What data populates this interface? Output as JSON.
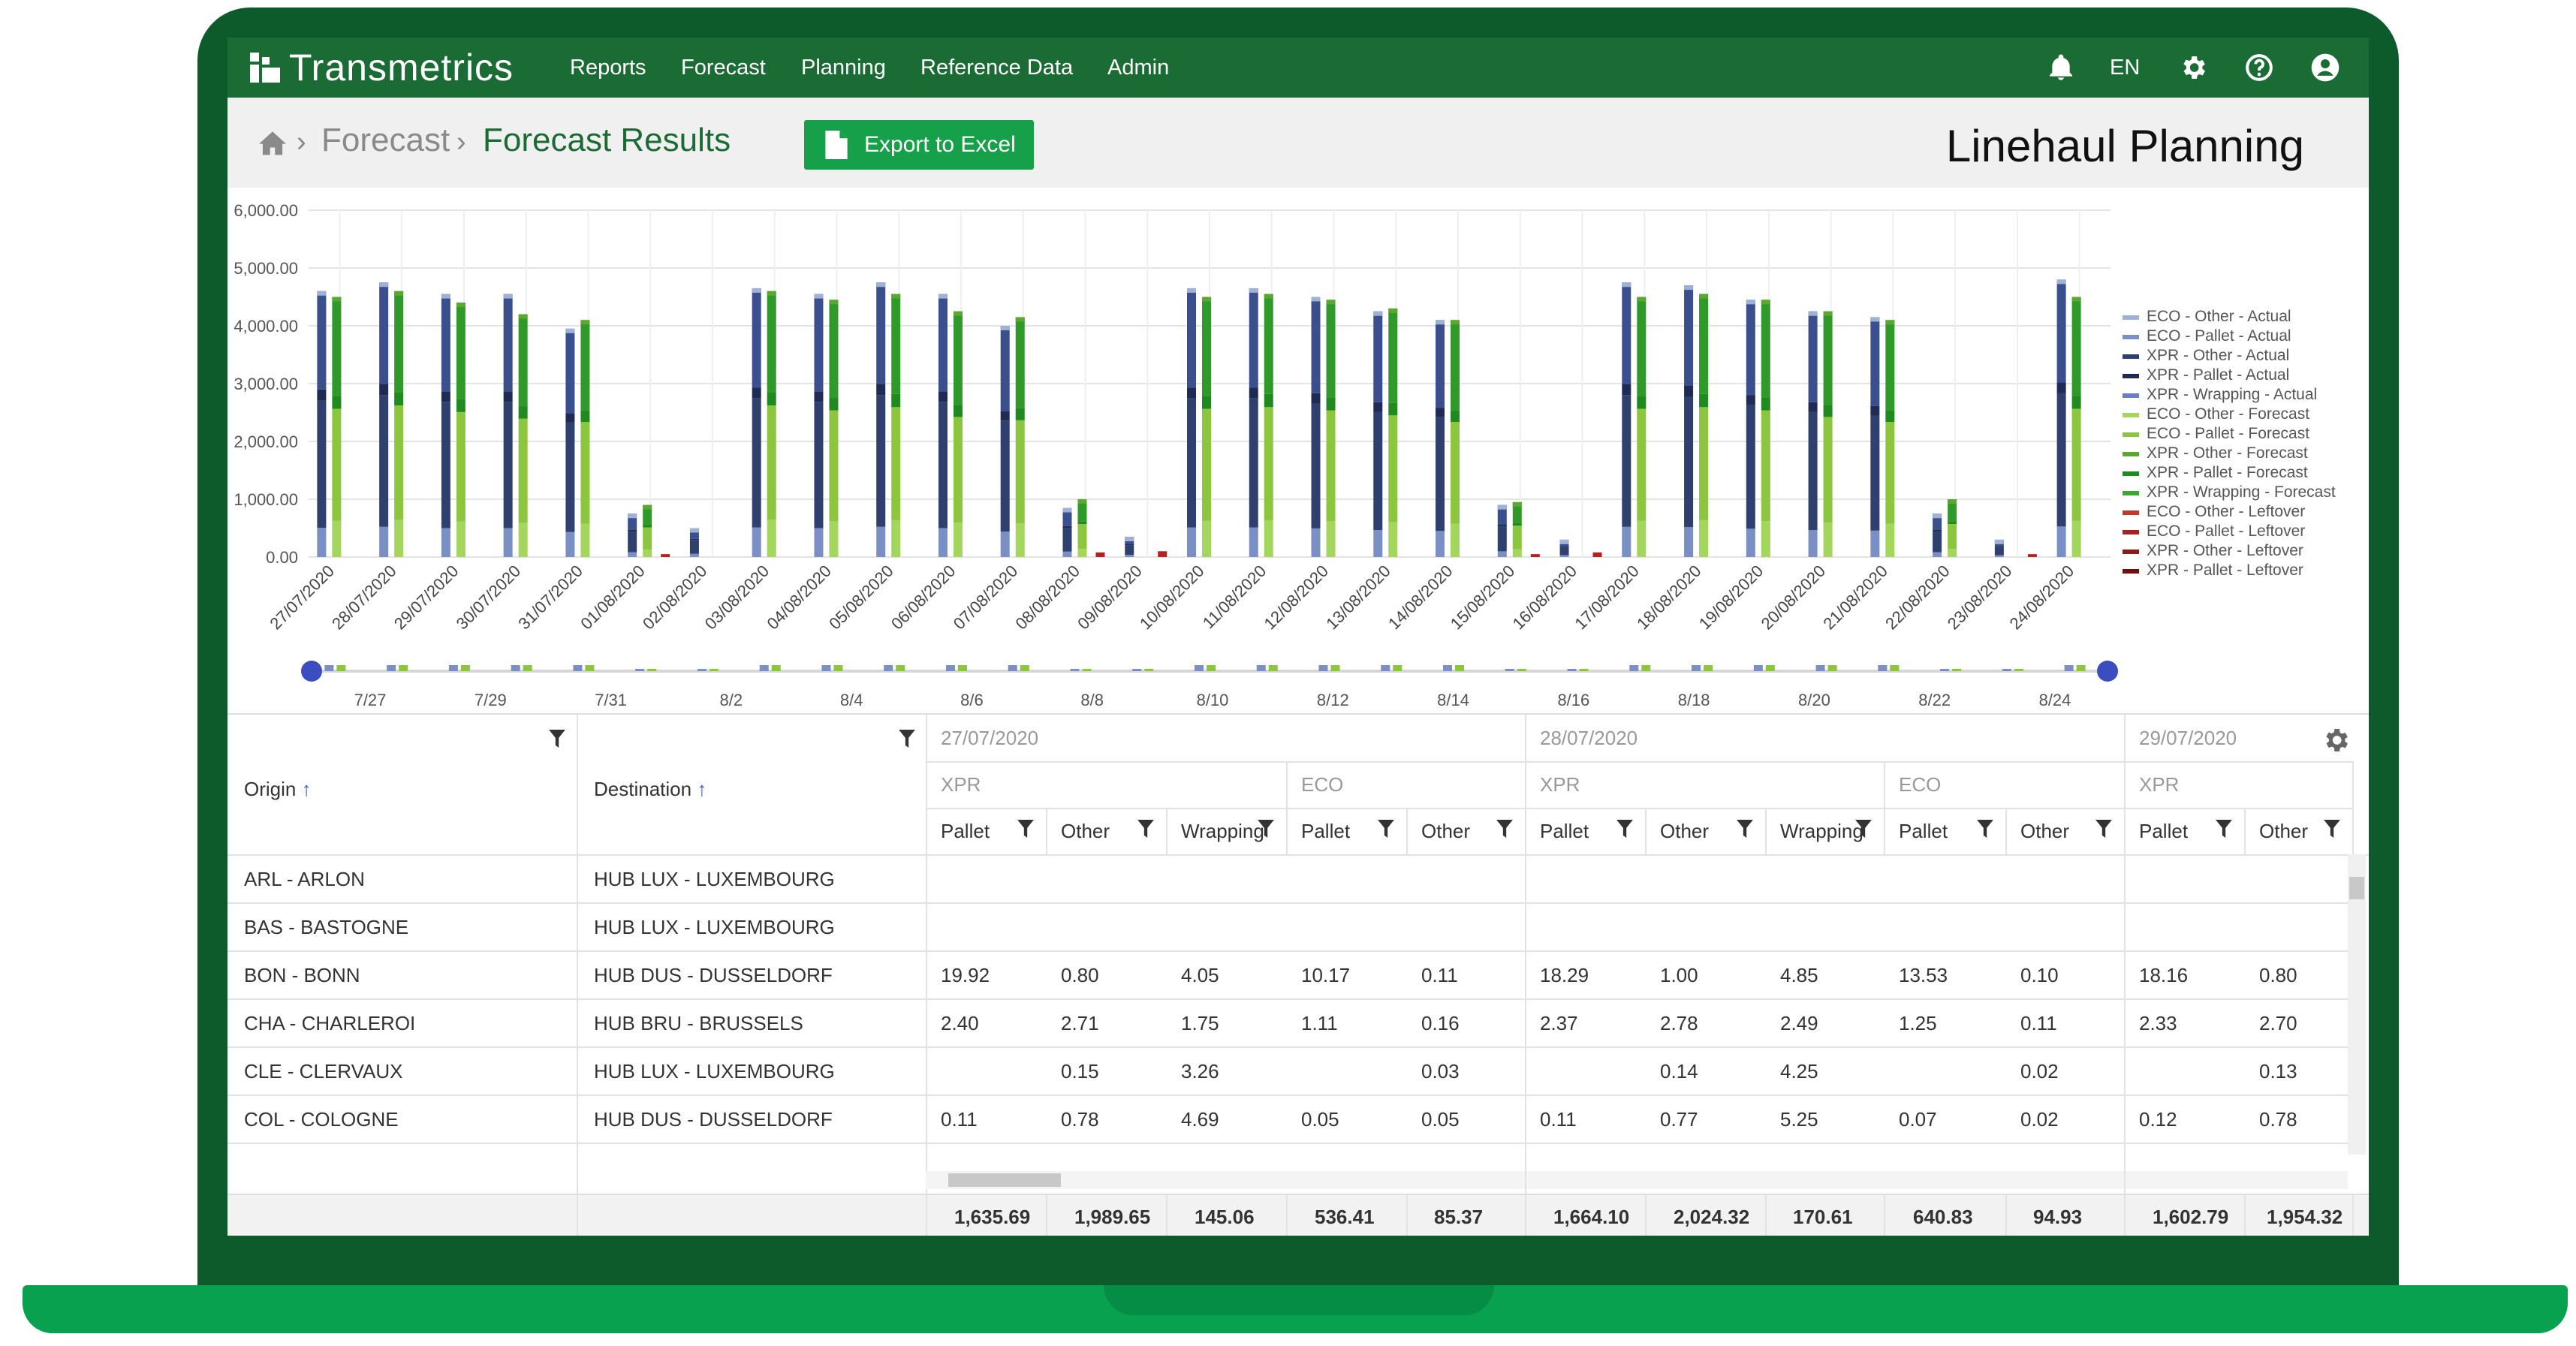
{
  "app": {
    "brand": "Transmetrics"
  },
  "nav": {
    "items": [
      "Reports",
      "Forecast",
      "Planning",
      "Reference Data",
      "Admin"
    ],
    "lang": "EN",
    "icons": [
      "bell-icon",
      "gear-icon",
      "help-icon",
      "user-icon"
    ]
  },
  "breadcrumb": {
    "parent": "Forecast",
    "current": "Forecast Results"
  },
  "toolbar": {
    "export_label": "Export to Excel"
  },
  "page": {
    "heading": "Linehaul Planning"
  },
  "colors": {
    "nav": "#1b6b34",
    "accent": "#17a04a"
  },
  "chart_data": {
    "type": "bar",
    "stacked": true,
    "grid": true,
    "legend_position": "right",
    "ylim": [
      0,
      6000
    ],
    "yticks": [
      "6,000.00",
      "5,000.00",
      "4,000.00",
      "3,000.00",
      "2,000.00",
      "1,000.00",
      "0.00"
    ],
    "categories": [
      "27/07/2020",
      "28/07/2020",
      "29/07/2020",
      "30/07/2020",
      "31/07/2020",
      "01/08/2020",
      "02/08/2020",
      "03/08/2020",
      "04/08/2020",
      "05/08/2020",
      "06/08/2020",
      "07/08/2020",
      "08/08/2020",
      "09/08/2020",
      "10/08/2020",
      "11/08/2020",
      "12/08/2020",
      "13/08/2020",
      "14/08/2020",
      "15/08/2020",
      "16/08/2020",
      "17/08/2020",
      "18/08/2020",
      "19/08/2020",
      "20/08/2020",
      "21/08/2020",
      "22/08/2020",
      "23/08/2020",
      "24/08/2020"
    ],
    "actual_totals": [
      4600,
      4750,
      4550,
      4550,
      3950,
      750,
      500,
      4650,
      4550,
      4750,
      4550,
      4000,
      850,
      350,
      4650,
      4650,
      4500,
      4250,
      4100,
      900,
      300,
      4750,
      4700,
      4450,
      4250,
      4150,
      750,
      300,
      4800
    ],
    "forecast_totals": [
      4500,
      4600,
      4400,
      4200,
      4100,
      900,
      0,
      4600,
      4450,
      4550,
      4250,
      4150,
      1000,
      0,
      4500,
      4550,
      4450,
      4300,
      4100,
      950,
      0,
      4500,
      4550,
      4450,
      4250,
      4100,
      1000,
      0,
      4500
    ],
    "leftover_totals": [
      0,
      0,
      0,
      0,
      0,
      50,
      0,
      0,
      0,
      0,
      0,
      0,
      80,
      100,
      0,
      0,
      0,
      0,
      0,
      50,
      80,
      0,
      0,
      0,
      0,
      0,
      0,
      50,
      0
    ],
    "legend": [
      {
        "name": "ECO - Other - Actual",
        "color": "#9fb1d6"
      },
      {
        "name": "ECO - Pallet - Actual",
        "color": "#7a8fc4"
      },
      {
        "name": "XPR - Other - Actual",
        "color": "#2f3f6e"
      },
      {
        "name": "XPR - Pallet - Actual",
        "color": "#1f2b55"
      },
      {
        "name": "XPR - Wrapping - Actual",
        "color": "#6a7fbf"
      },
      {
        "name": "ECO - Other - Forecast",
        "color": "#a4d65e"
      },
      {
        "name": "ECO - Pallet - Forecast",
        "color": "#8cc63f"
      },
      {
        "name": "XPR - Other - Forecast",
        "color": "#5aa832"
      },
      {
        "name": "XPR - Pallet - Forecast",
        "color": "#1f8a1f"
      },
      {
        "name": "XPR - Wrapping - Forecast",
        "color": "#3fa535"
      },
      {
        "name": "ECO - Other - Leftover",
        "color": "#c0392b"
      },
      {
        "name": "ECO - Pallet - Leftover",
        "color": "#a82020"
      },
      {
        "name": "XPR - Other - Leftover",
        "color": "#8c1a1a"
      },
      {
        "name": "XPR - Pallet - Leftover",
        "color": "#6e1010"
      }
    ],
    "navigator_labels": [
      "7/27",
      "7/29",
      "7/31",
      "8/2",
      "8/4",
      "8/6",
      "8/8",
      "8/10",
      "8/12",
      "8/14",
      "8/16",
      "8/18",
      "8/20",
      "8/22",
      "8/24"
    ]
  },
  "table": {
    "origin_header": "Origin",
    "destination_header": "Destination",
    "date_groups": [
      "27/07/2020",
      "28/07/2020",
      "29/07/2020"
    ],
    "subgroups": [
      "XPR",
      "ECO",
      "XPR",
      "ECO",
      "XPR"
    ],
    "columns": [
      "Pallet",
      "Other",
      "Wrapping",
      "Pallet",
      "Other",
      "Pallet",
      "Other",
      "Wrapping",
      "Pallet",
      "Other",
      "Pallet",
      "Other"
    ],
    "rows": [
      {
        "origin": "ARL - ARLON",
        "destination": "HUB LUX - LUXEMBOURG",
        "values": [
          "",
          "",
          "",
          "",
          "",
          "",
          "",
          "",
          "",
          "",
          "",
          ""
        ]
      },
      {
        "origin": "BAS - BASTOGNE",
        "destination": "HUB LUX - LUXEMBOURG",
        "values": [
          "",
          "",
          "",
          "",
          "",
          "",
          "",
          "",
          "",
          "",
          "",
          ""
        ]
      },
      {
        "origin": "BON - BONN",
        "destination": "HUB DUS - DUSSELDORF",
        "values": [
          "19.92",
          "0.80",
          "4.05",
          "10.17",
          "0.11",
          "18.29",
          "1.00",
          "4.85",
          "13.53",
          "0.10",
          "18.16",
          "0.80"
        ]
      },
      {
        "origin": "CHA - CHARLEROI",
        "destination": "HUB BRU - BRUSSELS",
        "values": [
          "2.40",
          "2.71",
          "1.75",
          "1.11",
          "0.16",
          "2.37",
          "2.78",
          "2.49",
          "1.25",
          "0.11",
          "2.33",
          "2.70"
        ]
      },
      {
        "origin": "CLE - CLERVAUX",
        "destination": "HUB LUX - LUXEMBOURG",
        "values": [
          "",
          "0.15",
          "3.26",
          "",
          "0.03",
          "",
          "0.14",
          "4.25",
          "",
          "0.02",
          "",
          "0.13"
        ]
      },
      {
        "origin": "COL - COLOGNE",
        "destination": "HUB DUS - DUSSELDORF",
        "values": [
          "0.11",
          "0.78",
          "4.69",
          "0.05",
          "0.05",
          "0.11",
          "0.77",
          "5.25",
          "0.07",
          "0.02",
          "0.12",
          "0.78"
        ]
      }
    ],
    "totals": [
      "1,635.69",
      "1,989.65",
      "145.06",
      "536.41",
      "85.37",
      "1,664.10",
      "2,024.32",
      "170.61",
      "640.83",
      "94.93",
      "1,602.79",
      "1,954.32"
    ]
  }
}
